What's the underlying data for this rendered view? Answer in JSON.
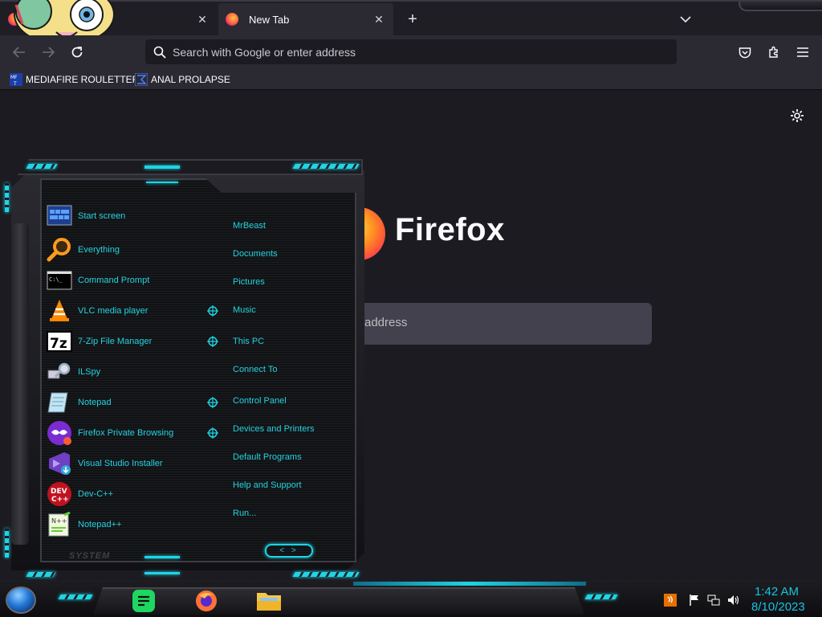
{
  "browser": {
    "tabs": [
      {
        "title": "",
        "close": "✕"
      },
      {
        "title": "New Tab",
        "close": "✕"
      }
    ],
    "new_tab": "+",
    "tab_list": "⌄",
    "urlbar_placeholder": "Search with Google or enter address",
    "bookmarks": [
      {
        "label": "MEDIAFIRE ROULETTER"
      },
      {
        "label": "ANAL PROLAPSE"
      }
    ]
  },
  "newtab_page": {
    "brand": "Firefox",
    "search_placeholder_visible": "address"
  },
  "start_menu": {
    "programs": [
      {
        "label": "Start screen",
        "icon": "start-screen-icon"
      },
      {
        "label": "Everything",
        "icon": "magnifier-icon"
      },
      {
        "label": "Command Prompt",
        "icon": "cmd-icon"
      },
      {
        "label": "VLC media player",
        "icon": "vlc-cone-icon"
      },
      {
        "label": "7-Zip File Manager",
        "icon": "7zip-icon"
      },
      {
        "label": "ILSpy",
        "icon": "ilspy-icon"
      },
      {
        "label": "Notepad",
        "icon": "notepad-icon"
      },
      {
        "label": "Firefox Private Browsing",
        "icon": "private-browsing-icon"
      },
      {
        "label": "Visual Studio Installer",
        "icon": "vs-installer-icon"
      },
      {
        "label": "Dev-C++",
        "icon": "devcpp-icon"
      },
      {
        "label": "Notepad++",
        "icon": "notepadpp-icon"
      }
    ],
    "places": [
      {
        "label": "MrBeast"
      },
      {
        "label": "Documents"
      },
      {
        "label": "Pictures"
      },
      {
        "label": "Music"
      },
      {
        "label": "This PC"
      },
      {
        "label": "Connect To"
      },
      {
        "label": "Control Panel"
      },
      {
        "label": "Devices and Printers"
      },
      {
        "label": "Default Programs"
      },
      {
        "label": "Help and Support"
      },
      {
        "label": "Run..."
      }
    ],
    "system_label": "SYSTEM",
    "power_arrows": "< >"
  },
  "taskbar": {
    "apps": [
      "notes-app-icon",
      "firefox-icon",
      "file-explorer-icon"
    ],
    "tray": [
      "java-icon",
      "flag-icon",
      "network-icon",
      "volume-icon"
    ],
    "time": "1:42 AM",
    "date": "8/10/2023"
  },
  "colors": {
    "accent_cyan": "#1fd4e4",
    "menu_text": "#22d3df",
    "browser_bg": "#1c1b22",
    "toolbar": "#2b2a33"
  }
}
